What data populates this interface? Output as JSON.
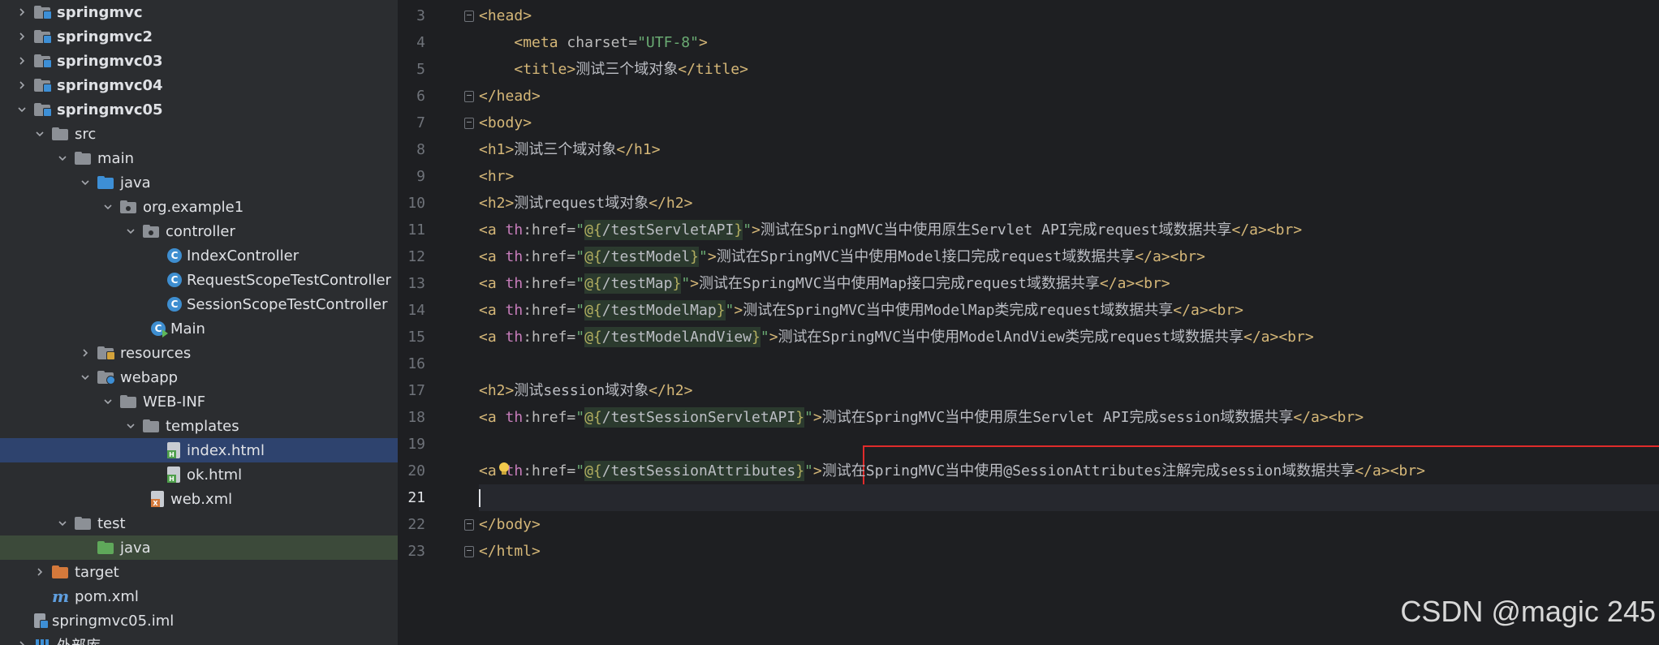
{
  "project_tree": {
    "items": [
      {
        "label": "springmvc",
        "arrow": "right",
        "icon": "module-folder-icon",
        "bold": true
      },
      {
        "label": "springmvc2",
        "arrow": "right",
        "icon": "module-folder-icon",
        "bold": true
      },
      {
        "label": "springmvc03",
        "arrow": "right",
        "icon": "module-folder-icon",
        "bold": true
      },
      {
        "label": "springmvc04",
        "arrow": "right",
        "icon": "module-folder-icon",
        "bold": true
      },
      {
        "label": "springmvc05",
        "arrow": "down",
        "icon": "module-folder-icon",
        "bold": true
      },
      {
        "label": "src",
        "arrow": "down",
        "icon": "folder-icon"
      },
      {
        "label": "main",
        "arrow": "down",
        "icon": "folder-icon"
      },
      {
        "label": "java",
        "arrow": "down",
        "icon": "source-folder-icon"
      },
      {
        "label": "org.example1",
        "arrow": "down",
        "icon": "package-icon"
      },
      {
        "label": "controller",
        "arrow": "down",
        "icon": "package-icon"
      },
      {
        "label": "IndexController",
        "arrow": "",
        "icon": "java-class-icon"
      },
      {
        "label": "RequestScopeTestController",
        "arrow": "",
        "icon": "java-class-icon"
      },
      {
        "label": "SessionScopeTestController",
        "arrow": "",
        "icon": "java-class-icon"
      },
      {
        "label": "Main",
        "arrow": "",
        "icon": "java-main-class-icon"
      },
      {
        "label": "resources",
        "arrow": "right",
        "icon": "resources-folder-icon"
      },
      {
        "label": "webapp",
        "arrow": "down",
        "icon": "web-folder-icon"
      },
      {
        "label": "WEB-INF",
        "arrow": "down",
        "icon": "folder-icon"
      },
      {
        "label": "templates",
        "arrow": "down",
        "icon": "folder-icon"
      },
      {
        "label": "index.html",
        "arrow": "",
        "icon": "html-file-icon",
        "selected": true
      },
      {
        "label": "ok.html",
        "arrow": "",
        "icon": "html-file-icon"
      },
      {
        "label": "web.xml",
        "arrow": "",
        "icon": "xml-file-icon"
      },
      {
        "label": "test",
        "arrow": "down",
        "icon": "folder-icon"
      },
      {
        "label": "java",
        "arrow": "",
        "icon": "test-source-folder-icon",
        "highlighted": true
      },
      {
        "label": "target",
        "arrow": "right",
        "icon": "excluded-folder-icon"
      },
      {
        "label": "pom.xml",
        "arrow": "",
        "icon": "maven-icon"
      },
      {
        "label": "springmvc05.iml",
        "arrow": "",
        "icon": "iml-file-icon"
      },
      {
        "label": "外部库",
        "arrow": "right",
        "icon": "library-icon"
      }
    ]
  },
  "editor": {
    "current_line": "21",
    "lines": [
      {
        "num": "3",
        "fold": true,
        "text": "<head>"
      },
      {
        "num": "4",
        "text": "    <meta charset=\"UTF-8\">"
      },
      {
        "num": "5",
        "text": "    <title>测试三个域对象</title>"
      },
      {
        "num": "6",
        "fold": true,
        "text": "</head>"
      },
      {
        "num": "7",
        "fold": true,
        "text": "<body>"
      },
      {
        "num": "8",
        "text": "<h1>测试三个域对象</h1>"
      },
      {
        "num": "9",
        "text": "<hr>"
      },
      {
        "num": "10",
        "text": "<h2>测试request域对象</h2>"
      },
      {
        "num": "11",
        "text": "<a th:href=\"@{/testServletAPI}\">测试在SpringMVC当中使用原生Servlet API完成request域数据共享</a><br>"
      },
      {
        "num": "12",
        "text": "<a th:href=\"@{/testModel}\">测试在SpringMVC当中使用Model接口完成request域数据共享</a><br>"
      },
      {
        "num": "13",
        "text": "<a th:href=\"@{/testMap}\">测试在SpringMVC当中使用Map接口完成request域数据共享</a><br>"
      },
      {
        "num": "14",
        "text": "<a th:href=\"@{/testModelMap}\">测试在SpringMVC当中使用ModelMap类完成request域数据共享</a><br>"
      },
      {
        "num": "15",
        "text": "<a th:href=\"@{/testModelAndView}\">测试在SpringMVC当中使用ModelAndView类完成request域数据共享</a><br>"
      },
      {
        "num": "16",
        "text": ""
      },
      {
        "num": "17",
        "text": "<h2>测试session域对象</h2>"
      },
      {
        "num": "18",
        "text": "<a th:href=\"@{/testSessionServletAPI}\">测试在SpringMVC当中使用原生Servlet API完成session域数据共享</a><br>"
      },
      {
        "num": "19",
        "text": ""
      },
      {
        "num": "20",
        "text": "<a th:href=\"@{/testSessionAttributes}\">测试在SpringMVC当中使用@SessionAttributes注解完成session域数据共享</a><br>"
      },
      {
        "num": "21",
        "text": ""
      },
      {
        "num": "22",
        "fold": true,
        "text": "</body>"
      },
      {
        "num": "23",
        "fold": true,
        "text": "</html>"
      }
    ]
  },
  "colors": {
    "tag": "#d5b778",
    "attr_value": "#6aab73",
    "thymeleaf_attr": "#c77dbb",
    "annotation_box": "#e02b2b"
  },
  "watermark": "CSDN @magic 245"
}
